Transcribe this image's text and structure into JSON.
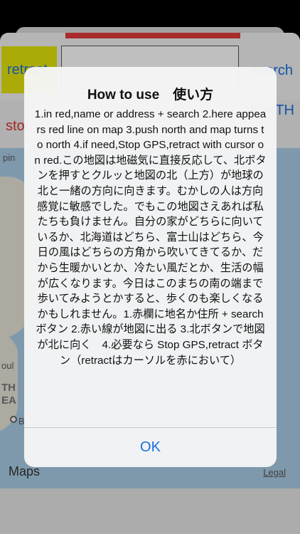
{
  "toolbar": {
    "retract_label": "retract",
    "search_label": "search",
    "north_label": "NORTH",
    "stop_label": "stop"
  },
  "map": {
    "labels": [
      "pin",
      "oul",
      "TH",
      "EA",
      "B"
    ],
    "brand": "Maps",
    "legal": "Legal"
  },
  "alert": {
    "title": "How to use　使い方",
    "message": "1.in red,name or address + search 2.here appears red line on map 3.push north and map turns to  north 4.if need,Stop GPS,retract with cursor on red.この地図は地磁気に直接反応して、北ボタンを押すとクルッと地図の北（上方）が地球の北と一緒の方向に向きます。むかしの人は方向感覚に敏感でした。でもこの地図さえあれば私たちも負けません。自分の家がどちらに向いているか、北海道はどちら、富士山はどちら、今日の風はどちらの方角から吹いてきてるか、だから生暖かいとか、冷たい風だとか、生活の幅が広くなります。今日はこのまちの南の端まで歩いてみようとかすると、歩くのも楽しくなるかもしれません。1.赤欄に地名か住所 + searchボタン 2.赤い線が地図に出る 3.北ボタンで地図が北に向く　4.必要なら Stop GPS,retract ボタン（retractはカーソルを赤において）",
    "ok_label": "OK"
  },
  "colors": {
    "accent": "#1a6fe0",
    "retract_bg": "#e3e40c",
    "red": "#e23b3b",
    "water": "#a9cde6"
  }
}
